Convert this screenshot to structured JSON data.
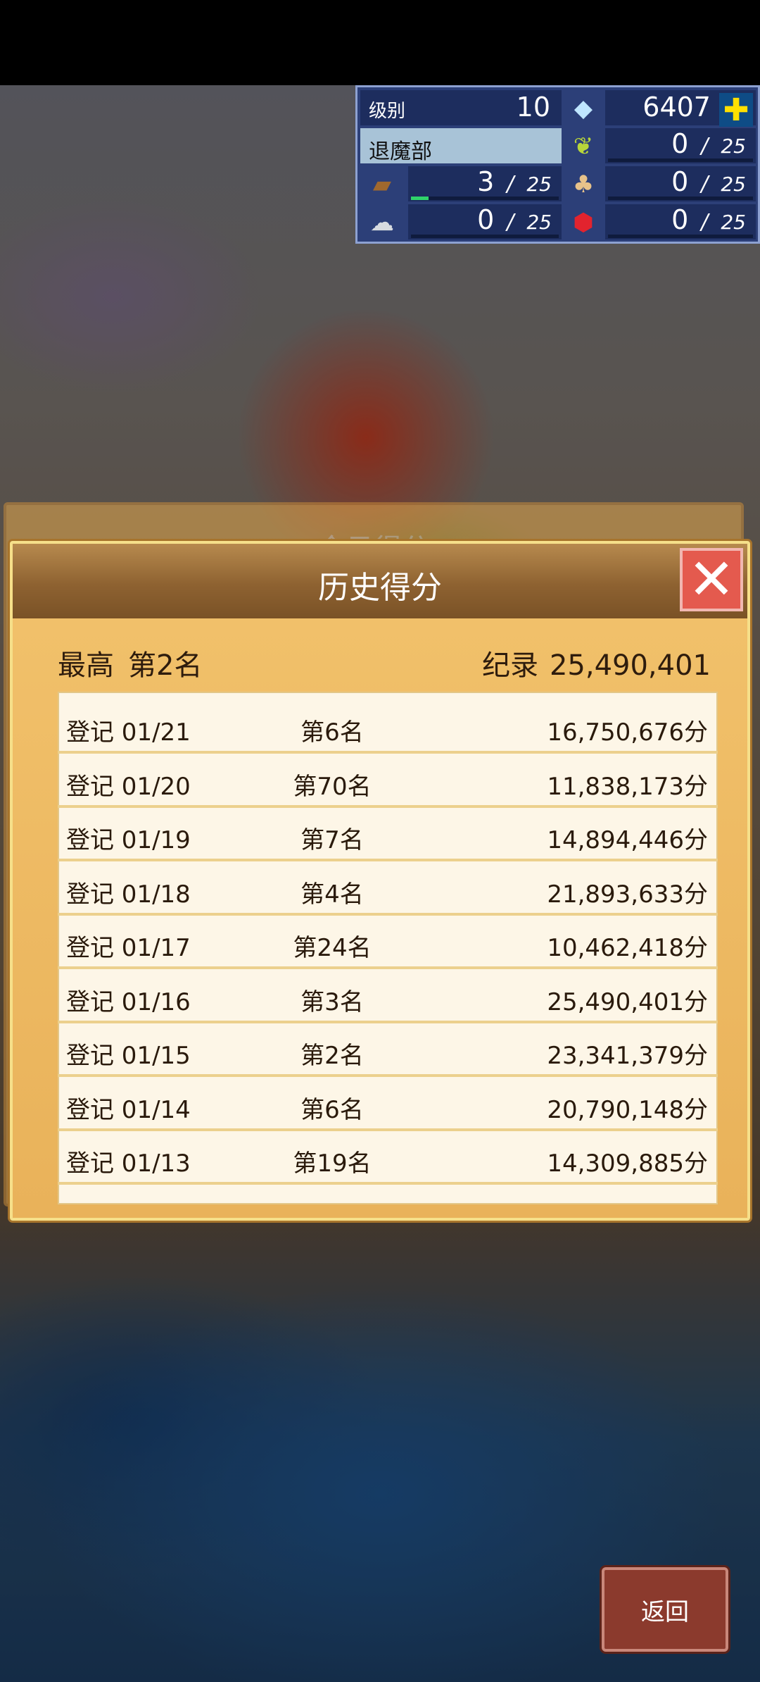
{
  "hud": {
    "level_label": "级别",
    "level_value": "10",
    "gems": "6407",
    "club_name": "退魔部",
    "resources": [
      {
        "icon": "grass-icon",
        "current": "0",
        "max": "25"
      },
      {
        "icon": "wood-log-icon",
        "current": "3",
        "max": "25",
        "fill": 0.12
      },
      {
        "icon": "food-basket-icon",
        "current": "0",
        "max": "25"
      },
      {
        "icon": "stone-icon",
        "current": "0",
        "max": "25"
      },
      {
        "icon": "ruby-icon",
        "current": "0",
        "max": "25"
      }
    ]
  },
  "back_panel_title": "今日得分",
  "panel": {
    "title": "历史得分",
    "best_label": "最高",
    "best_rank": "第2名",
    "record_label": "纪录",
    "record_value": "25,490,401"
  },
  "rows": [
    {
      "date": "登记 01/21",
      "rank": "第6名",
      "score": "16,750,676分"
    },
    {
      "date": "登记 01/20",
      "rank": "第70名",
      "score": "11,838,173分"
    },
    {
      "date": "登记 01/19",
      "rank": "第7名",
      "score": "14,894,446分"
    },
    {
      "date": "登记 01/18",
      "rank": "第4名",
      "score": "21,893,633分"
    },
    {
      "date": "登记 01/17",
      "rank": "第24名",
      "score": "10,462,418分"
    },
    {
      "date": "登记 01/16",
      "rank": "第3名",
      "score": "25,490,401分"
    },
    {
      "date": "登记 01/15",
      "rank": "第2名",
      "score": "23,341,379分"
    },
    {
      "date": "登记 01/14",
      "rank": "第6名",
      "score": "20,790,148分"
    },
    {
      "date": "登记 01/13",
      "rank": "第19名",
      "score": "14,309,885分"
    }
  ],
  "back_button": "返回"
}
